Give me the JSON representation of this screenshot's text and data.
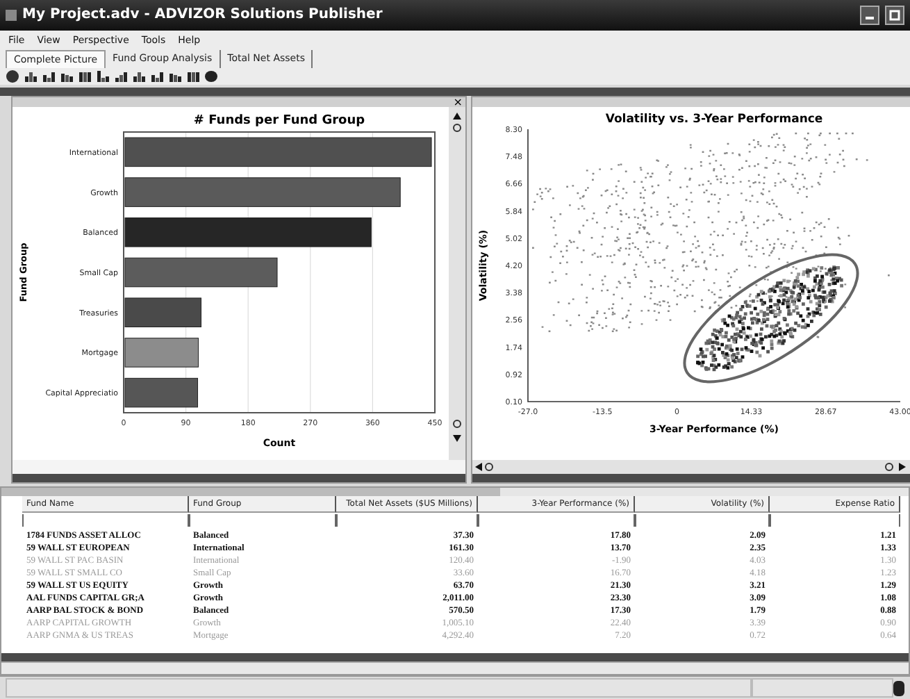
{
  "window": {
    "title": "My Project.adv - ADVIZOR Solutions Publisher"
  },
  "menu": [
    "File",
    "View",
    "Perspective",
    "Tools",
    "Help"
  ],
  "tabs": [
    {
      "label": "Complete Picture",
      "selected": true
    },
    {
      "label": "Fund Group Analysis",
      "selected": false
    },
    {
      "label": "Total Net Assets",
      "selected": false
    }
  ],
  "bar_panel": {
    "close": "×",
    "chart_data": {
      "type": "bar",
      "orientation": "horizontal",
      "title": "# Funds per Fund Group",
      "xlabel": "Count",
      "ylabel": "Fund Group",
      "categories": [
        "International",
        "Growth",
        "Balanced",
        "Small Cap",
        "Treasuries",
        "Mortgage",
        "Capital Appreciatio"
      ],
      "values": [
        445,
        400,
        358,
        222,
        112,
        108,
        107
      ],
      "xlim": [
        0,
        450
      ],
      "xticks": [
        0,
        90,
        180,
        270,
        360,
        450
      ],
      "grid": true
    }
  },
  "scatter_panel": {
    "title": "Volatility vs. 3-Year Performance",
    "xlabel": "3-Year Performance (%)",
    "ylabel": "Volatility (%)",
    "xticks": [
      "-27.0",
      "-13.5",
      "0",
      "14.33",
      "28.67",
      "43.00"
    ],
    "yticks": [
      "8.30",
      "7.48",
      "6.66",
      "5.84",
      "5.02",
      "4.20",
      "3.38",
      "2.56",
      "1.74",
      "0.92",
      "0.10"
    ]
  },
  "table": {
    "columns": [
      "Fund Name",
      "Fund Group",
      "Total Net Assets ($US Millions)",
      "3-Year Performance (%)",
      "Volatility (%)",
      "Expense Ratio"
    ],
    "rows": [
      {
        "cells": [
          "1784 FUNDS ASSET ALLOC",
          "Balanced",
          "37.30",
          "17.80",
          "2.09",
          "1.21"
        ],
        "highlighted": true
      },
      {
        "cells": [
          "59 WALL ST EUROPEAN",
          "International",
          "161.30",
          "13.70",
          "2.35",
          "1.33"
        ],
        "highlighted": true
      },
      {
        "cells": [
          "59 WALL ST PAC BASIN",
          "International",
          "120.40",
          "-1.90",
          "4.03",
          "1.30"
        ],
        "highlighted": false
      },
      {
        "cells": [
          "59 WALL ST SMALL CO",
          "Small Cap",
          "33.60",
          "16.70",
          "4.18",
          "1.23"
        ],
        "highlighted": false
      },
      {
        "cells": [
          "59 WALL ST US EQUITY",
          "Growth",
          "63.70",
          "21.30",
          "3.21",
          "1.29"
        ],
        "highlighted": true
      },
      {
        "cells": [
          "AAL FUNDS CAPITAL GR;A",
          "Growth",
          "2,011.00",
          "23.30",
          "3.09",
          "1.08"
        ],
        "highlighted": true
      },
      {
        "cells": [
          "AARP BAL STOCK & BOND",
          "Balanced",
          "570.50",
          "17.30",
          "1.79",
          "0.88"
        ],
        "highlighted": true
      },
      {
        "cells": [
          "AARP CAPITAL GROWTH",
          "Growth",
          "1,005.10",
          "22.40",
          "3.39",
          "0.90"
        ],
        "highlighted": false
      },
      {
        "cells": [
          "AARP GNMA & US TREAS",
          "Mortgage",
          "4,292.40",
          "7.20",
          "0.72",
          "0.64"
        ],
        "highlighted": false
      }
    ]
  }
}
